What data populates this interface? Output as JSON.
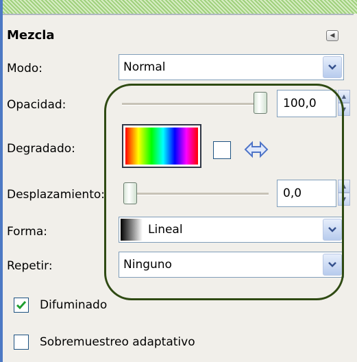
{
  "section": {
    "title": "Mezcla"
  },
  "mode": {
    "label": "Modo:",
    "value": "Normal"
  },
  "opacity": {
    "label": "Opacidad:",
    "value": "100,0",
    "fraction": 1.0
  },
  "gradient": {
    "label": "Degradado:"
  },
  "offset": {
    "label": "Desplazamiento:",
    "value": "0,0",
    "fraction": 0.0
  },
  "shape": {
    "label": "Forma:",
    "value": "Lineal"
  },
  "repeat": {
    "label": "Repetir:",
    "value": "Ninguno"
  },
  "options": {
    "dither": {
      "label": "Difuminado",
      "checked": true
    },
    "adaptive": {
      "label": "Sobremuestreo adaptativo",
      "checked": false
    }
  },
  "colors": {
    "accent": "#4d79c4",
    "highlight_oval": "#2f4a13",
    "check": "#1f9f2f"
  }
}
